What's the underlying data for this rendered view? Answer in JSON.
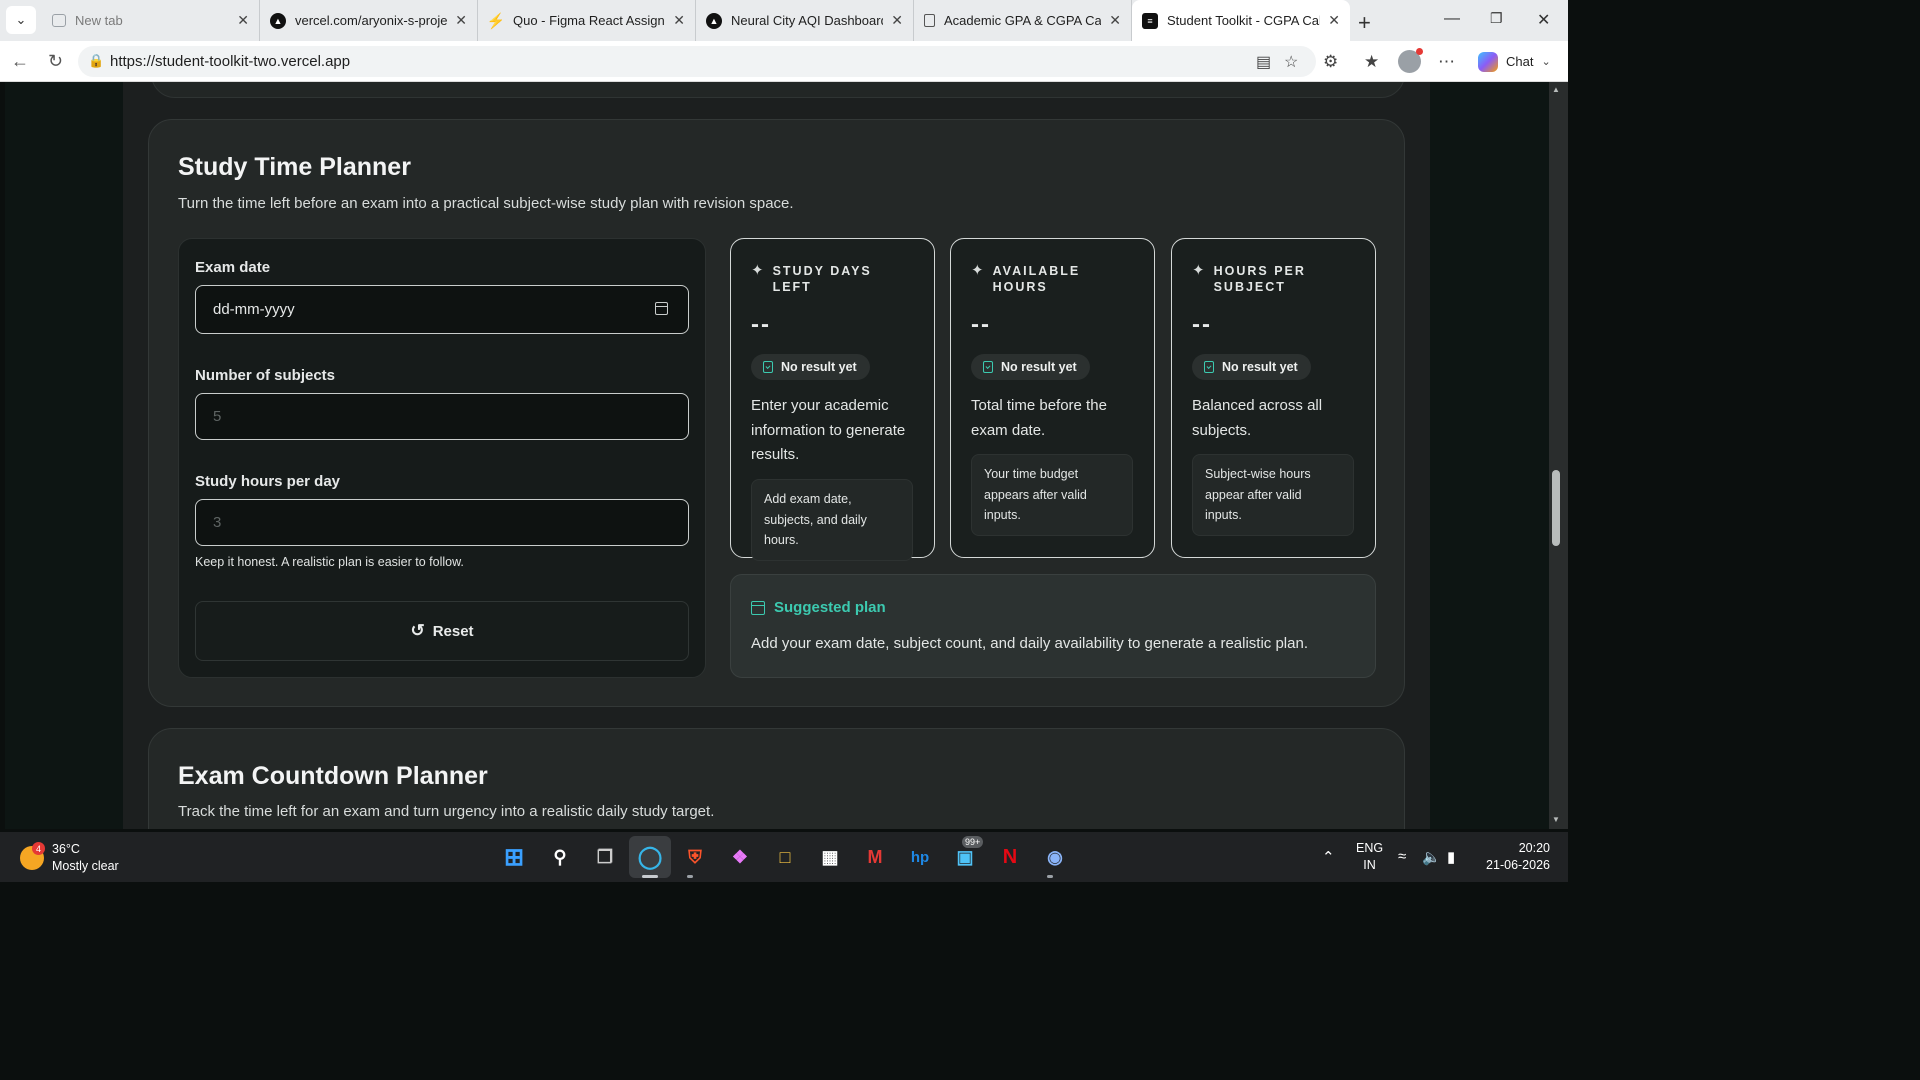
{
  "browser": {
    "tabs": [
      {
        "title": "New tab",
        "icon": "new-tab-icon",
        "dim": true
      },
      {
        "title": "vercel.com/aryonix-s-projects",
        "icon": "vercel-icon"
      },
      {
        "title": "Quo - Figma React Assignment",
        "icon": "quo-icon"
      },
      {
        "title": "Neural City AQI Dashboard",
        "icon": "vercel-icon"
      },
      {
        "title": "Academic GPA & CGPA Calcul",
        "icon": "calculator-icon"
      },
      {
        "title": "Student Toolkit - CGPA Calcul",
        "icon": "toolkit-icon",
        "active": true
      }
    ],
    "url": "https://student-toolkit-two.vercel.app",
    "chat_label": "Chat"
  },
  "planner": {
    "title": "Study Time Planner",
    "subtitle": "Turn the time left before an exam into a practical subject-wise study plan with revision space.",
    "exam_date_label": "Exam date",
    "exam_date_value": "dd-mm-yyyy",
    "subjects_label": "Number of subjects",
    "subjects_placeholder": "5",
    "hours_label": "Study hours per day",
    "hours_placeholder": "3",
    "hint": "Keep it honest. A realistic plan is easier to follow.",
    "reset_label": "Reset",
    "stats": [
      {
        "title_line1": "STUDY DAYS",
        "title_line2": "LEFT",
        "value": "--",
        "badge": "No result yet",
        "desc": "Enter your academic information to generate results.",
        "note": "Add exam date, subjects, and daily hours."
      },
      {
        "title_line1": "AVAILABLE",
        "title_line2": "HOURS",
        "value": "--",
        "badge": "No result yet",
        "desc": "Total time before the exam date.",
        "note": "Your time budget appears after valid inputs."
      },
      {
        "title_line1": "HOURS PER",
        "title_line2": "SUBJECT",
        "value": "--",
        "badge": "No result yet",
        "desc": "Balanced across all subjects.",
        "note": "Subject-wise hours appear after valid inputs."
      }
    ],
    "plan_title": "Suggested plan",
    "plan_text": "Add your exam date, subject count, and daily availability to generate a realistic plan."
  },
  "countdown": {
    "title": "Exam Countdown Planner",
    "subtitle": "Track the time left for an exam and turn urgency into a realistic daily study target."
  },
  "taskbar": {
    "temperature": "36°C",
    "weather": "Mostly clear",
    "weather_badge": "4",
    "notif_badge": "99+",
    "lang_line1": "ENG",
    "lang_line2": "IN",
    "time": "20:20",
    "date": "21-06-2026"
  },
  "colors": {
    "accent": "#3ccab0",
    "page_bg": "#1c1f1f",
    "card_bg": "#242827"
  }
}
